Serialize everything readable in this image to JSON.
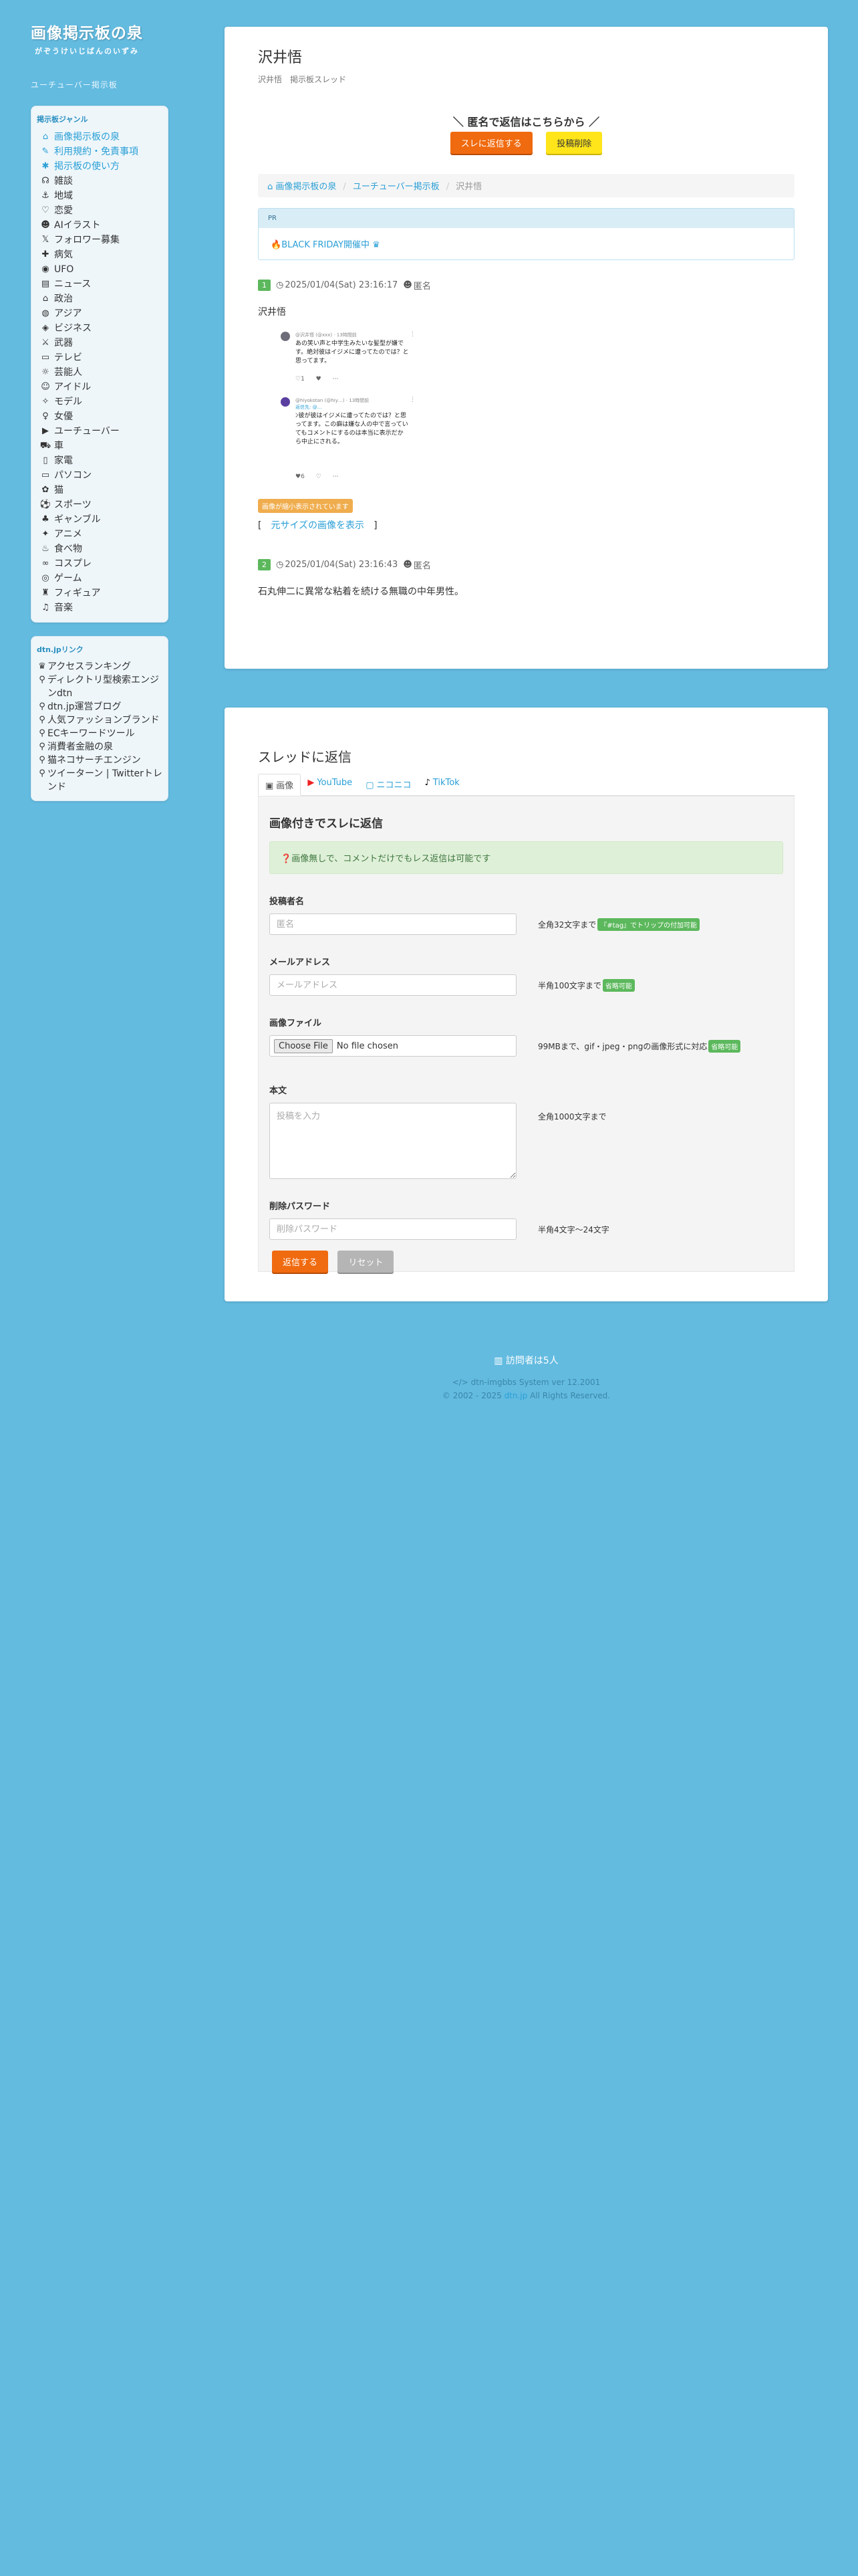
{
  "sidebar": {
    "title": "画像掲示板の泉",
    "reading": "がぞうけいじばんのいずみ",
    "subtitle": "ユーチューバー掲示板",
    "genre_panel": {
      "heading": "掲示板ジャンル",
      "top_links": [
        {
          "icon": "⌂",
          "label": "画像掲示板の泉"
        },
        {
          "icon": "✎",
          "label": "利用規約・免責事項"
        },
        {
          "icon": "✱",
          "label": "掲示板の使い方"
        }
      ],
      "items": [
        {
          "icon": "☊",
          "label": "雑談"
        },
        {
          "icon": "⚓",
          "label": "地域"
        },
        {
          "icon": "♡",
          "label": "恋愛"
        },
        {
          "icon": "☻",
          "label": "AIイラスト"
        },
        {
          "icon": "𝕏",
          "label": "フォロワー募集"
        },
        {
          "icon": "✚",
          "label": "病気"
        },
        {
          "icon": "◉",
          "label": "UFO"
        },
        {
          "icon": "▤",
          "label": "ニュース"
        },
        {
          "icon": "⌂",
          "label": "政治"
        },
        {
          "icon": "◍",
          "label": "アジア"
        },
        {
          "icon": "◈",
          "label": "ビジネス"
        },
        {
          "icon": "⚔",
          "label": "武器"
        },
        {
          "icon": "▭",
          "label": "テレビ"
        },
        {
          "icon": "☼",
          "label": "芸能人"
        },
        {
          "icon": "☺",
          "label": "アイドル"
        },
        {
          "icon": "✧",
          "label": "モデル"
        },
        {
          "icon": "♀",
          "label": "女優"
        },
        {
          "icon": "▶",
          "label": "ユーチューバー"
        },
        {
          "icon": "⛟",
          "label": "車"
        },
        {
          "icon": "▯",
          "label": "家電"
        },
        {
          "icon": "▭",
          "label": "パソコン"
        },
        {
          "icon": "✿",
          "label": "猫"
        },
        {
          "icon": "⚽",
          "label": "スポーツ"
        },
        {
          "icon": "♣",
          "label": "ギャンブル"
        },
        {
          "icon": "✦",
          "label": "アニメ"
        },
        {
          "icon": "♨",
          "label": "食べ物"
        },
        {
          "icon": "∞",
          "label": "コスプレ"
        },
        {
          "icon": "◎",
          "label": "ゲーム"
        },
        {
          "icon": "♜",
          "label": "フィギュア"
        },
        {
          "icon": "♫",
          "label": "音楽"
        }
      ]
    },
    "links_panel": {
      "heading": "dtn.jpリンク",
      "items": [
        {
          "icon": "♛",
          "label": "アクセスランキング"
        },
        {
          "icon": "⚲",
          "label": "ディレクトリ型検索エンジンdtn"
        },
        {
          "icon": "⚲",
          "label": "dtn.jp運営ブログ"
        },
        {
          "icon": "⚲",
          "label": "人気ファッションブランド"
        },
        {
          "icon": "⚲",
          "label": "ECキーワードツール"
        },
        {
          "icon": "⚲",
          "label": "消費者金融の泉"
        },
        {
          "icon": "⚲",
          "label": "猫ネコサーチエンジン"
        },
        {
          "icon": "⚲",
          "label": "ツイーターン | Twitterトレンド"
        }
      ]
    }
  },
  "thread": {
    "title": "沢井悟",
    "subtitle": "沢井悟　掲示板スレッド",
    "reply_prompt": "＼ 匿名で返信はこちらから ／",
    "reply_button": "スレに返信する",
    "delete_button": "投稿削除",
    "breadcrumb": [
      "画像掲示板の泉",
      "ユーチューバー掲示板",
      "沢井悟"
    ],
    "pr": {
      "heading": "PR",
      "text": "BLACK FRIDAY開催中"
    },
    "posts": [
      {
        "number": "1",
        "date": "2025/01/04(Sat) 23:16:17",
        "author": "匿名",
        "body": "沢井悟",
        "notice": "画像が縮小表示されています",
        "orig_open": "[",
        "orig_link": "元サイズの画像を表示",
        "orig_close": "]",
        "tweet": {
          "first": {
            "handle": "@沢井悟 (@xxx) · 13時間前",
            "text": "あの笑い声と中学生みたいな髪型が嫌です。絶対彼はイジメに遭ってたのでは？と思ってます。",
            "actions": "♡1 ♥ ⋯"
          },
          "second": {
            "handle": "@hiyokotan (@hiy…) · 13時間前",
            "reply": "返信先: @…",
            "text": "ﾝ彼が彼はイジメに遭ってたのでは？と思ってます。この癖は嫌な人の中で言っていてもコメントにするのは本当に表示だから中止にされる。",
            "actions": "♥6 ♡ ⋯"
          }
        }
      },
      {
        "number": "2",
        "date": "2025/01/04(Sat) 23:16:43",
        "author": "匿名",
        "body": "石丸伸二に異常な粘着を続ける無職の中年男性。"
      }
    ]
  },
  "reply_form": {
    "title": "スレッドに返信",
    "tabs": [
      {
        "label": "画像"
      },
      {
        "label": "YouTube"
      },
      {
        "label": "ニコニコ"
      },
      {
        "label": "TikTok"
      }
    ],
    "form_title": "画像付きでスレに返信",
    "info": "画像無しで、コメントだけでもレス返信は可能です",
    "fields": {
      "name": {
        "label": "投稿者名",
        "placeholder": "匿名",
        "hint": "全角32文字まで",
        "badge": "『#tag』でトリップの付加可能"
      },
      "email": {
        "label": "メールアドレス",
        "placeholder": "メールアドレス",
        "hint": "半角100文字まで",
        "badge": "省略可能"
      },
      "file": {
        "label": "画像ファイル",
        "button": "Choose File",
        "status": "No file chosen",
        "hint": "99MBまで、gif・jpeg・pngの画像形式に対応",
        "badge": "省略可能"
      },
      "body": {
        "label": "本文",
        "placeholder": "投稿を入力",
        "hint": "全角1000文字まで"
      },
      "password": {
        "label": "削除パスワード",
        "placeholder": "削除パスワード",
        "hint": "半角4文字〜24文字"
      }
    },
    "submit": "返信する",
    "reset": "リセット"
  },
  "footer": {
    "visitors": "訪問者は5人",
    "version": "</> dtn-imgbbs System ver 12.2001",
    "copyright_prefix": "© 2002 - 2025",
    "copyright_link": "dtn.jp",
    "copyright_suffix": "All Rights Reserved."
  },
  "colors": {
    "background": "#63bbe0",
    "accent_orange": "#f06a0f",
    "accent_yellow": "#ffe51a",
    "link_blue": "#2a9fd6",
    "badge_green": "#5cb85c"
  }
}
